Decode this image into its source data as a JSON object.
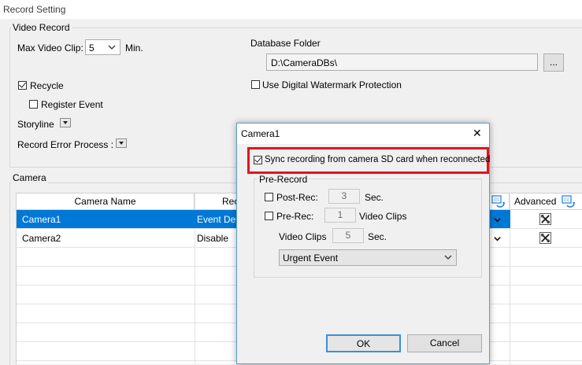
{
  "window": {
    "title": "Record Setting"
  },
  "video_record": {
    "group_title": "Video Record",
    "max_clip_label": "Max Video Clip:",
    "max_clip_value": "5",
    "max_clip_unit": "Min.",
    "recycle_label": "Recycle",
    "recycle_checked": true,
    "register_event_label": "Register Event",
    "register_event_checked": false,
    "storyline_label": "Storyline",
    "record_error_label": "Record Error Process :",
    "db_folder_label": "Database Folder",
    "db_folder_value": "D:\\CameraDBs\\",
    "browse_label": "...",
    "watermark_label": "Use Digital Watermark Protection",
    "watermark_checked": false
  },
  "camera": {
    "group_title": "Camera",
    "columns": {
      "name": "Camera Name",
      "record": "Rec",
      "advanced": "Advanced"
    },
    "rows": [
      {
        "name": "Camera1",
        "record": "Event Dete",
        "selected": true
      },
      {
        "name": "Camera2",
        "record": "Disable",
        "selected": false
      }
    ]
  },
  "dialog": {
    "title": "Camera1",
    "close_label": "✕",
    "sync_label": "Sync recording from camera SD card when reconnected",
    "sync_checked": true,
    "prerecord_title": "Pre-Record",
    "post_rec_label": "Post-Rec:",
    "post_rec_value": "3",
    "post_rec_unit": "Sec.",
    "pre_rec_label": "Pre-Rec:",
    "pre_rec_value": "1",
    "pre_rec_unit": "Video Clips",
    "video_clips_label": "Video Clips",
    "video_clips_value": "5",
    "video_clips_unit": "Sec.",
    "event_select_value": "Urgent Event",
    "ok_label": "OK",
    "cancel_label": "Cancel"
  },
  "colors": {
    "selection": "#0078d7",
    "highlight_box": "#e3141f",
    "accent_icon": "#1e7fd6"
  }
}
